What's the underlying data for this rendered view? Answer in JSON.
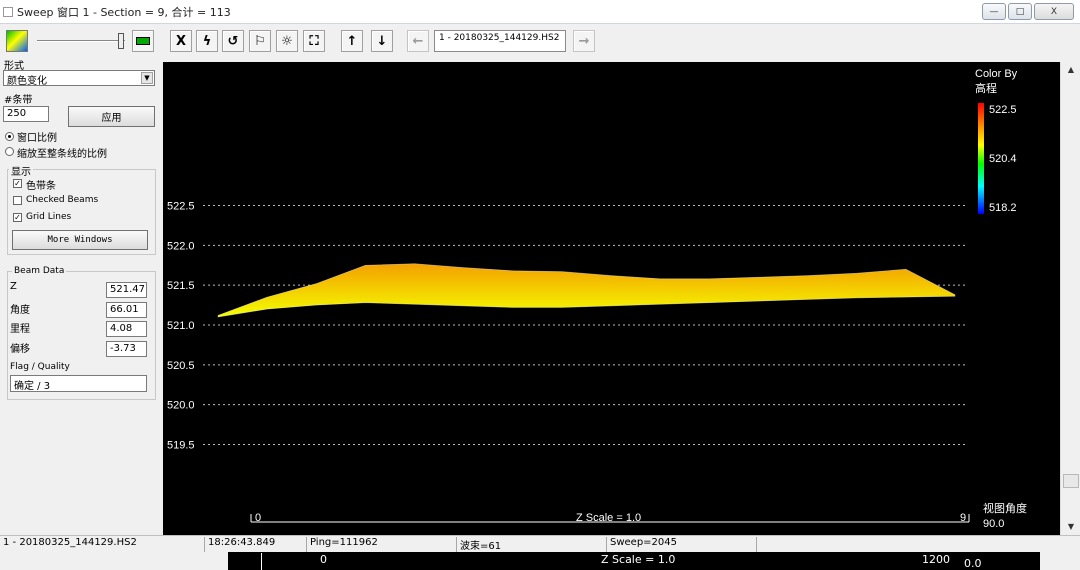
{
  "window": {
    "title": "Sweep 窗口 1 - Section = 9, 合计 = 113",
    "min_label": "—",
    "max_label": "□",
    "close_label": "X"
  },
  "toolbar": {
    "file_value": "1 - 20180325_144129.HS2",
    "tools": [
      {
        "name": "x-cut-icon",
        "glyph": "X"
      },
      {
        "name": "lightning-icon",
        "glyph": "ϟ"
      },
      {
        "name": "undo-icon",
        "glyph": "↺"
      },
      {
        "name": "flag-icon",
        "glyph": "⚐"
      },
      {
        "name": "sun-icon",
        "glyph": "☼"
      },
      {
        "name": "fit-view-icon",
        "glyph": "⛶"
      },
      {
        "name": "up-arrow-icon",
        "glyph": "↑"
      },
      {
        "name": "down-arrow-icon",
        "glyph": "↓"
      },
      {
        "name": "left-arrow-icon",
        "glyph": "←"
      },
      {
        "name": "right-arrow-icon",
        "glyph": "→"
      }
    ]
  },
  "panel": {
    "style_label": "形式",
    "style_value": "颜色变化",
    "bands_label": "#条带",
    "bands_value": "250",
    "apply_label": "应用",
    "radio_window": "窗口比例",
    "radio_fit": "缩放至整条线的比例",
    "display_title": "显示",
    "check_colorbar": "色带条",
    "check_beams": "Checked Beams",
    "check_grid": "Grid Lines",
    "more_windows": "More Windows",
    "beam_title": "Beam Data",
    "beam_rows": [
      {
        "label": "Z",
        "value": "521.47"
      },
      {
        "label": "角度",
        "value": "66.01"
      },
      {
        "label": "里程",
        "value": "4.08"
      },
      {
        "label": "偏移",
        "value": "-3.73"
      }
    ],
    "flag_label": "Flag / Quality",
    "flag_value": "确定 / 3"
  },
  "plot": {
    "background": "#000000",
    "colorbar_title_1": "Color By",
    "colorbar_title_2": "高程",
    "colorbar_ticks": [
      "522.5",
      "520.4",
      "518.2"
    ],
    "y_ticks": [
      "522.5",
      "522.0",
      "521.5",
      "521.0",
      "520.5",
      "520.0",
      "519.5"
    ],
    "x_start": "0",
    "x_end": "9",
    "z_scale": "Z Scale = 1.0",
    "view_angle_label": "视图角度",
    "view_angle_value": "90.0",
    "point_color_top": "#f4a000",
    "point_color_bottom": "#f4ff00"
  },
  "status": {
    "file": "1 - 20180325_144129.HS2",
    "time": "18:26:43.849",
    "ping": "Ping=111962",
    "beam": "波束=61",
    "sweep": "Sweep=2045"
  },
  "bottom": {
    "x_start": "0",
    "z_scale": "Z Scale = 1.0",
    "x_end": "1200",
    "value": "0.0"
  },
  "chart_data": {
    "type": "scatter",
    "title": "",
    "xlabel": "",
    "ylabel": "",
    "xlim": [
      0,
      9
    ],
    "ylim": [
      519.5,
      522.5
    ],
    "grid": true,
    "legend": "none",
    "colorbar": {
      "label": "高程",
      "min": 518.2,
      "mid": 520.4,
      "max": 522.5
    },
    "series": [
      {
        "x": [
          0.0,
          0.6,
          1.2,
          1.8,
          2.4,
          3.0,
          3.6,
          4.2,
          4.8,
          5.4,
          6.0,
          6.6,
          7.2,
          7.8,
          8.4,
          9.0
        ],
        "upper": [
          521.12,
          521.35,
          521.52,
          521.75,
          521.77,
          521.72,
          521.68,
          521.67,
          521.62,
          521.58,
          521.58,
          521.6,
          521.62,
          521.65,
          521.7,
          521.38
        ],
        "lower": [
          521.1,
          521.2,
          521.25,
          521.28,
          521.26,
          521.24,
          521.22,
          521.22,
          521.24,
          521.26,
          521.28,
          521.3,
          521.32,
          521.34,
          521.35,
          521.36
        ]
      }
    ]
  }
}
